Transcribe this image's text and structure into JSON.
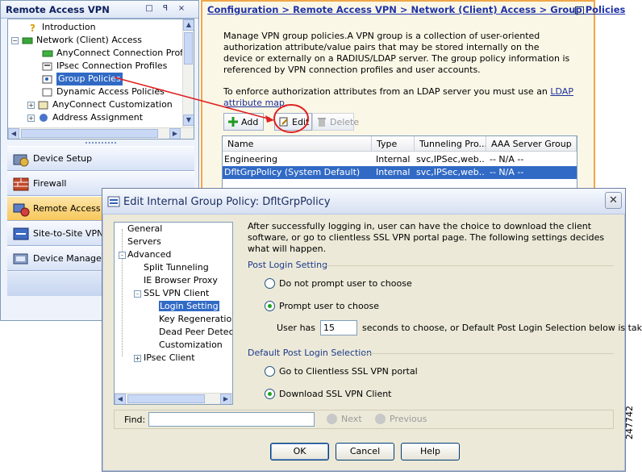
{
  "nav": {
    "title": "Remote Access VPN",
    "header_buttons": [
      "□",
      "ꟼ",
      "×"
    ],
    "tree": [
      {
        "label": "Introduction",
        "icon": "help-icon",
        "level": 1
      },
      {
        "label": "Network (Client) Access",
        "icon": "network-folder-icon",
        "level": 0
      },
      {
        "label": "AnyConnect Connection Profiles",
        "icon": "profile-icon",
        "level": 2
      },
      {
        "label": "IPsec Connection Profiles",
        "icon": "profile-icon",
        "level": 2
      },
      {
        "label": "Group Policies",
        "icon": "group-policy-icon",
        "level": 2,
        "selected": true
      },
      {
        "label": "Dynamic Access Policies",
        "icon": "policy-icon",
        "level": 2
      },
      {
        "label": "AnyConnect Customization",
        "icon": "customize-icon",
        "level": 2
      },
      {
        "label": "Address Assignment",
        "icon": "address-icon",
        "level": 2
      }
    ],
    "buttons": [
      {
        "label": "Device Setup",
        "icon": "device-setup-icon"
      },
      {
        "label": "Firewall",
        "icon": "firewall-icon"
      },
      {
        "label": "Remote Access VPN",
        "icon": "remote-access-icon",
        "active": true
      },
      {
        "label": "Site-to-Site VPN",
        "icon": "site-to-site-icon"
      },
      {
        "label": "Device Management",
        "icon": "device-management-icon"
      }
    ]
  },
  "config": {
    "breadcrumb": "Configuration > Remote Access VPN > Network (Client) Access > Group Policies",
    "description": "Manage VPN group policies.A VPN group is a collection of user-oriented authorization attribute/value pairs that may be stored internally on the device or externally on a RADIUS/LDAP server. The group policy information is referenced by VPN connection profiles and user accounts.",
    "ldap_text": "To enforce authorization attributes from an LDAP server you must use an ",
    "ldap_link": "LDAP attribute map",
    "ldap_end": ".",
    "toolbar": {
      "add": "Add",
      "edit": "Edit",
      "delete": "Delete"
    },
    "columns": [
      "Name",
      "Type",
      "Tunneling Pro...",
      "AAA Server Group"
    ],
    "rows": [
      {
        "name": "Engineering",
        "type": "Internal",
        "tunneling": "svc,IPSec,web...",
        "aaa": "-- N/A --",
        "selected": false
      },
      {
        "name": "DfltGrpPolicy (System Default)",
        "type": "Internal",
        "tunneling": "svc,IPSec,web...",
        "aaa": "-- N/A --",
        "selected": true
      }
    ]
  },
  "dialog": {
    "title": "Edit Internal Group Policy: DfltGrpPolicy",
    "tree": [
      {
        "label": "General",
        "level": 0
      },
      {
        "label": "Servers",
        "level": 0
      },
      {
        "label": "Advanced",
        "level": 0,
        "expander": "-"
      },
      {
        "label": "Split Tunneling",
        "level": 1
      },
      {
        "label": "IE Browser Proxy",
        "level": 1
      },
      {
        "label": "SSL VPN Client",
        "level": 1,
        "expander": "-"
      },
      {
        "label": "Login Setting",
        "level": 2,
        "selected": true
      },
      {
        "label": "Key Regeneration",
        "level": 2
      },
      {
        "label": "Dead Peer Detectio",
        "level": 2
      },
      {
        "label": "Customization",
        "level": 2
      },
      {
        "label": "IPsec Client",
        "level": 1,
        "expander": "+"
      }
    ],
    "info": "After successfully logging in, user can have the choice to download the client software, or go to clientless SSL VPN portal page. The following settings decides what will happen.",
    "post_login": {
      "title": "Post Login Setting",
      "opt1": "Do not prompt user to choose",
      "opt2": "Prompt user to choose",
      "selected": 2,
      "user_has": "User has",
      "seconds_value": "15",
      "seconds_text": "seconds to choose, or Default Post Login Selection below is taken."
    },
    "default_login": {
      "title": "Default Post Login Selection",
      "opt1": "Go to Clientless SSL VPN portal",
      "opt2": "Download SSL VPN Client",
      "selected": 2
    },
    "find": {
      "label": "Find:",
      "value": "",
      "next": "Next",
      "previous": "Previous"
    },
    "buttons": {
      "ok": "OK",
      "cancel": "Cancel",
      "help": "Help"
    }
  },
  "watermark": "247742",
  "colors": {
    "accent": "#316ac5",
    "config_border": "#f0a64a",
    "annotation": "#e02020"
  }
}
